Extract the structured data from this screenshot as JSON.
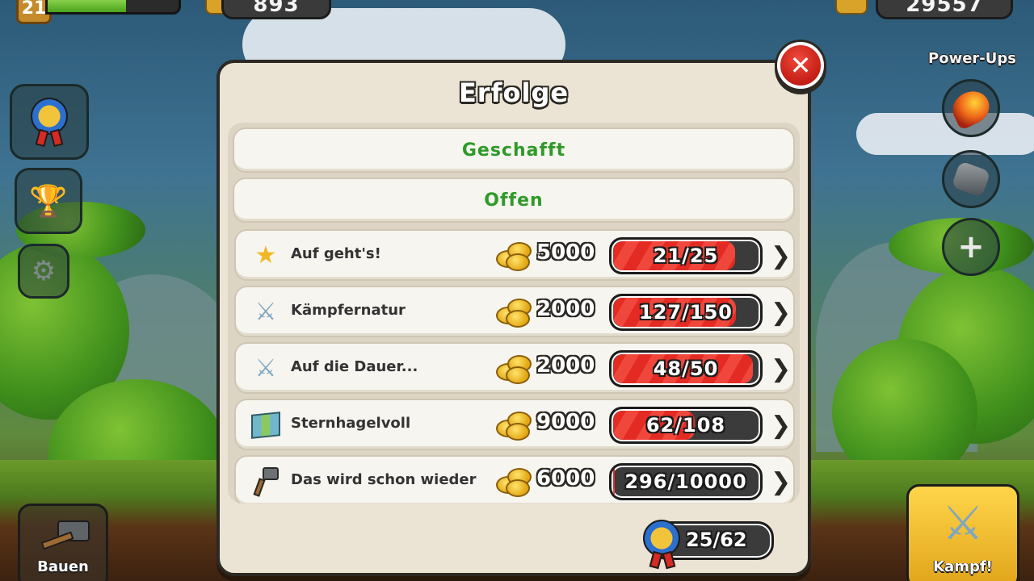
{
  "hud": {
    "level": "21",
    "xp_progress": 0.6,
    "gems": "893",
    "gold": "29557"
  },
  "sidebar": {
    "achievements_icon": "medal-icon",
    "trophy_icon": "trophy-icon",
    "settings_icon": "gear-icon"
  },
  "powerups": {
    "label": "Power-Ups",
    "items": [
      "meteor-icon",
      "rock-drop-icon",
      "plus-icon"
    ]
  },
  "bottom": {
    "build_label": "Bauen",
    "fight_label": "Kampf!"
  },
  "dialog": {
    "title": "Erfolge",
    "close_icon": "close-icon",
    "tabs": [
      {
        "label": "Geschafft"
      },
      {
        "label": "Offen"
      }
    ],
    "achievements": [
      {
        "icon": "star-icon",
        "title": "Auf geht's!",
        "reward": "5000",
        "progress_text": "21/25",
        "progress": 0.84
      },
      {
        "icon": "crossed-swords-icon",
        "title": "Kämpfernatur",
        "reward": "2000",
        "progress_text": "127/150",
        "progress": 0.85
      },
      {
        "icon": "crossed-swords-icon",
        "title": "Auf die Dauer...",
        "reward": "2000",
        "progress_text": "48/50",
        "progress": 0.96
      },
      {
        "icon": "map-icon",
        "title": "Sternhagelvoll",
        "reward": "9000",
        "progress_text": "62/108",
        "progress": 0.57
      },
      {
        "icon": "hammer-icon",
        "title": "Das wird schon wieder",
        "reward": "6000",
        "progress_text": "296/10000",
        "progress": 0.03
      }
    ],
    "total": "25/62"
  },
  "colors": {
    "tab_text": "#2f9a2a",
    "progress_red": "#e32b23",
    "dialog_bg": "#ebe3d3",
    "close_red": "#d62a1e"
  }
}
